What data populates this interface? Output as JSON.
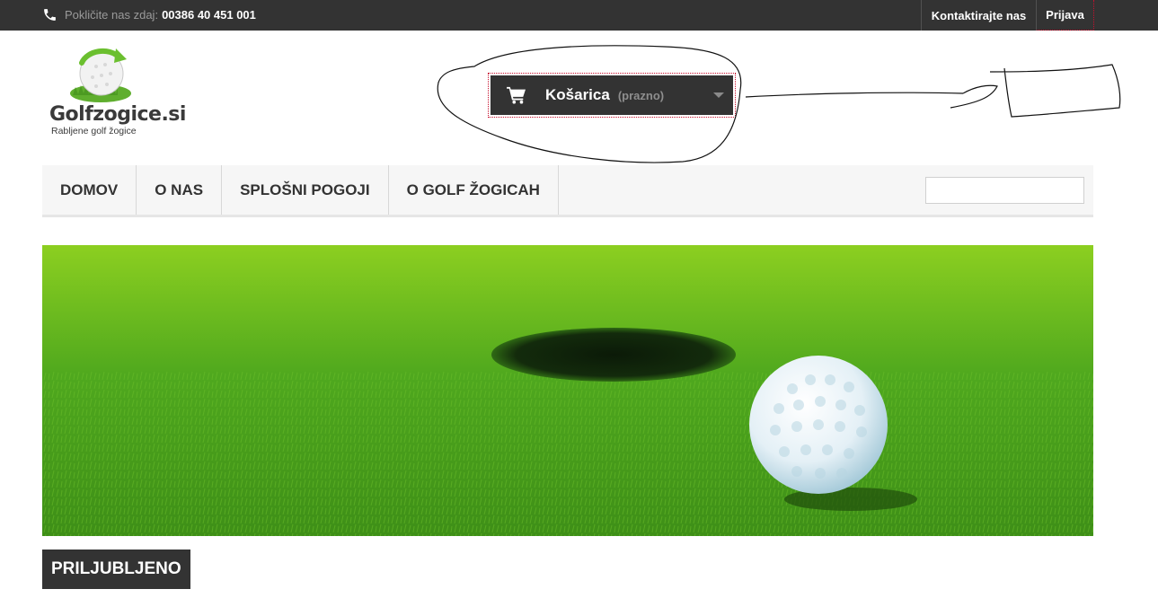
{
  "topbar": {
    "phone_prefix": "Pokličite nas zdaj:",
    "phone_number": "00386 40 451 001",
    "contact_label": "Kontaktirajte nas",
    "login_label": "Prijava",
    "phone_icon": "phone-icon"
  },
  "logo": {
    "name": "Golfzogice.si",
    "tagline": "Rabljene golf žogice"
  },
  "cart": {
    "label": "Košarica",
    "status": "(prazno)",
    "icon": "shopping-cart-icon"
  },
  "nav": {
    "items": [
      {
        "label": "DOMOV"
      },
      {
        "label": "O NAS"
      },
      {
        "label": "SPLOŠNI POGOJI"
      },
      {
        "label": "O GOLF ŽOGICAH"
      }
    ],
    "search_placeholder": ""
  },
  "section": {
    "title": "PRILJUBLJENO"
  },
  "colors": {
    "dark": "#333333",
    "accent_dotted": "#c8102e",
    "nav_bg": "#f6f6f6"
  }
}
